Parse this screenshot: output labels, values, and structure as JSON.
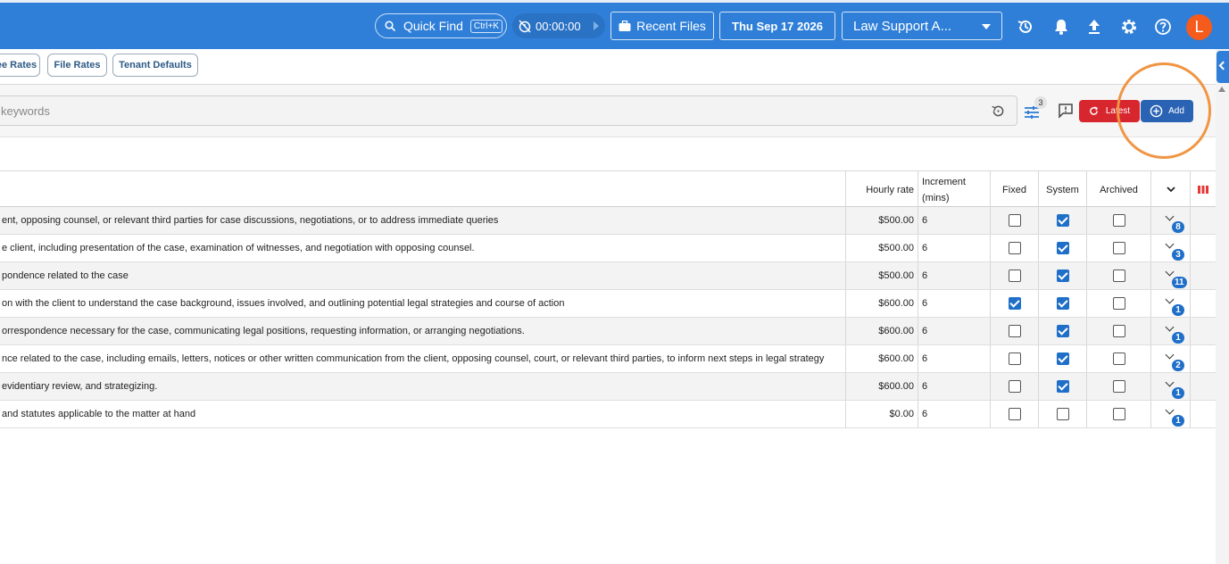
{
  "topbar": {
    "quick_find": "Quick Find",
    "shortcut": "Ctrl+K",
    "timer": "00:00:00",
    "recent_files": "Recent Files",
    "date": "Thu Sep 17 2026",
    "tenant": "Law Support A...",
    "avatar": "L",
    "color": "#2f7fd8"
  },
  "tabs": [
    "ee Rates",
    "File Rates",
    "Tenant Defaults"
  ],
  "search": {
    "placeholder": "keywords",
    "filter_count": "3",
    "latest_label": "Latest",
    "add_label": "Add"
  },
  "table": {
    "headers": {
      "rate": "Hourly rate",
      "increment_1": "Increment",
      "increment_2": "(mins)",
      "fixed": "Fixed",
      "system": "System",
      "archived": "Archived"
    },
    "rows": [
      {
        "desc": "ent, opposing counsel, or relevant third parties for case discussions, negotiations, or to address immediate queries",
        "rate": "$500.00",
        "inc": "6",
        "fixed": false,
        "system": true,
        "archived": false,
        "count": "8"
      },
      {
        "desc": "e client, including presentation of the case, examination of witnesses, and negotiation with opposing counsel.",
        "rate": "$500.00",
        "inc": "6",
        "fixed": false,
        "system": true,
        "archived": false,
        "count": "3"
      },
      {
        "desc": "pondence related to the case",
        "rate": "$500.00",
        "inc": "6",
        "fixed": false,
        "system": true,
        "archived": false,
        "count": "11"
      },
      {
        "desc": "on with the client to understand the case background, issues involved, and outlining potential legal strategies and course of action",
        "rate": "$600.00",
        "inc": "6",
        "fixed": true,
        "system": true,
        "archived": false,
        "count": "1"
      },
      {
        "desc": "orrespondence necessary for the case, communicating legal positions, requesting information, or arranging negotiations.",
        "rate": "$600.00",
        "inc": "6",
        "fixed": false,
        "system": true,
        "archived": false,
        "count": "1"
      },
      {
        "desc": "nce related to the case, including emails, letters, notices or other written communication from the client, opposing counsel, court, or relevant third parties, to inform next steps in legal strategy",
        "rate": "$600.00",
        "inc": "6",
        "fixed": false,
        "system": true,
        "archived": false,
        "count": "2"
      },
      {
        "desc": "evidentiary review, and strategizing.",
        "rate": "$600.00",
        "inc": "6",
        "fixed": false,
        "system": true,
        "archived": false,
        "count": "1"
      },
      {
        "desc": "and statutes applicable to the matter at hand",
        "rate": "$0.00",
        "inc": "6",
        "fixed": false,
        "system": false,
        "archived": false,
        "count": "1"
      }
    ]
  }
}
